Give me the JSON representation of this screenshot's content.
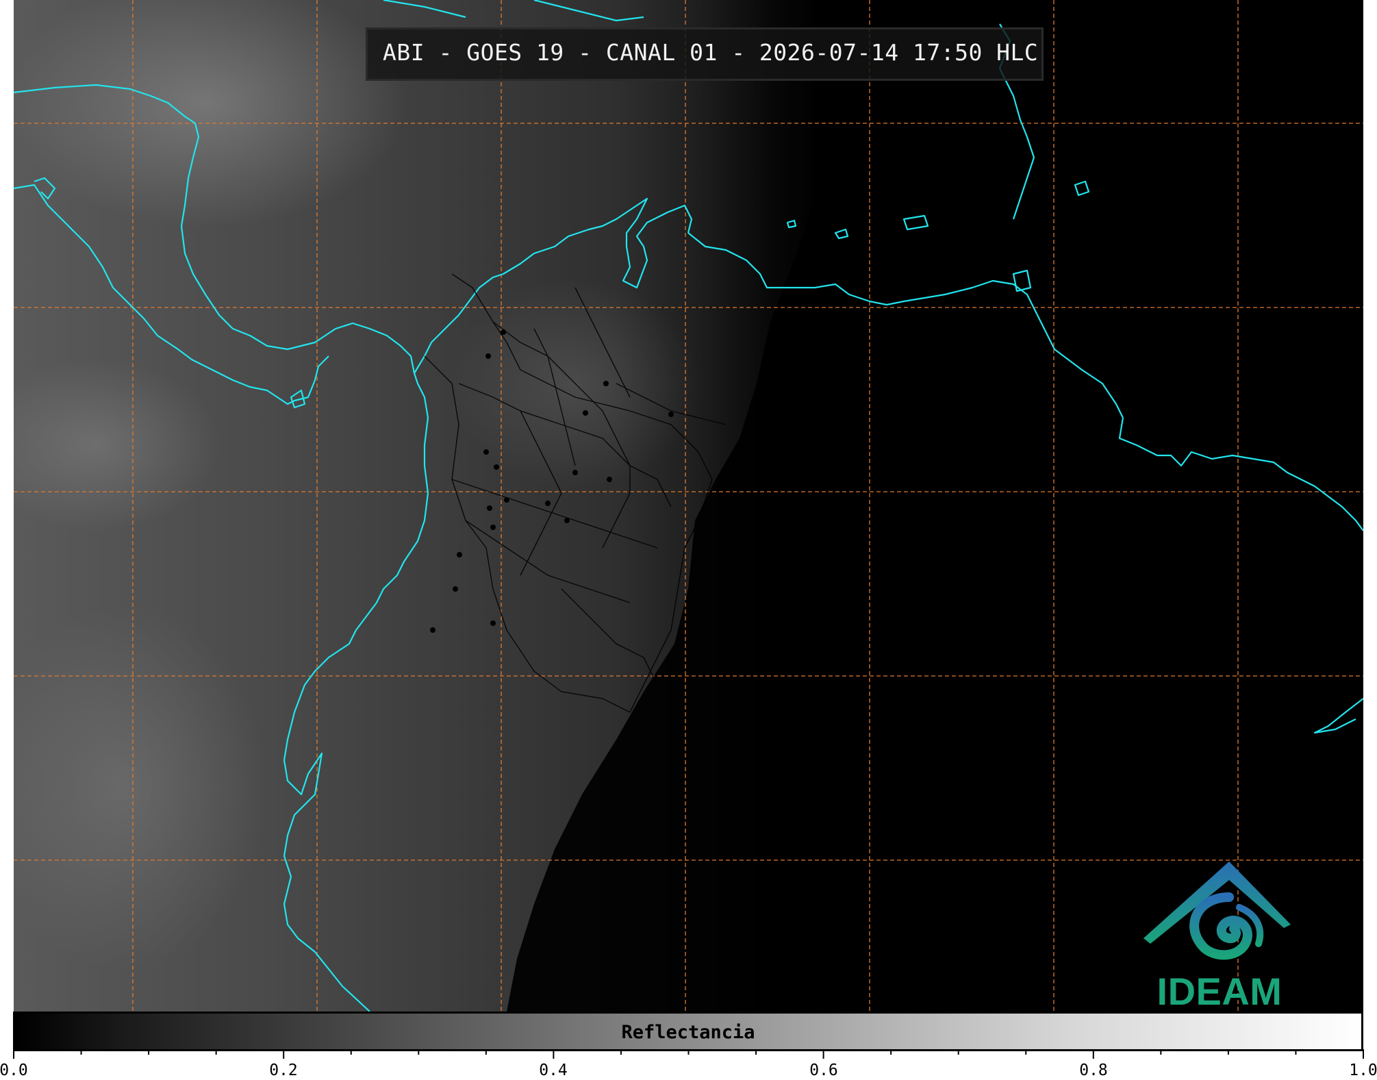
{
  "header": {
    "title": "ABI - GOES 19 - CANAL 01 - 2026-07-14 17:50 HLC"
  },
  "map": {
    "grid_color": "#e07a2e",
    "coastline_color": "#22e5ee",
    "border_color": "#000000",
    "day_night_terminator": "visible"
  },
  "logo": {
    "text": "IDEAM",
    "colors": [
      "#2a6fb5",
      "#1aa57a"
    ]
  },
  "colorbar": {
    "label": "Reflectancia",
    "range": [
      0.0,
      1.0
    ],
    "tick_labels": [
      "0.0",
      "0.2",
      "0.4",
      "0.6",
      "0.8",
      "1.0"
    ],
    "colormap": "grayscale"
  }
}
